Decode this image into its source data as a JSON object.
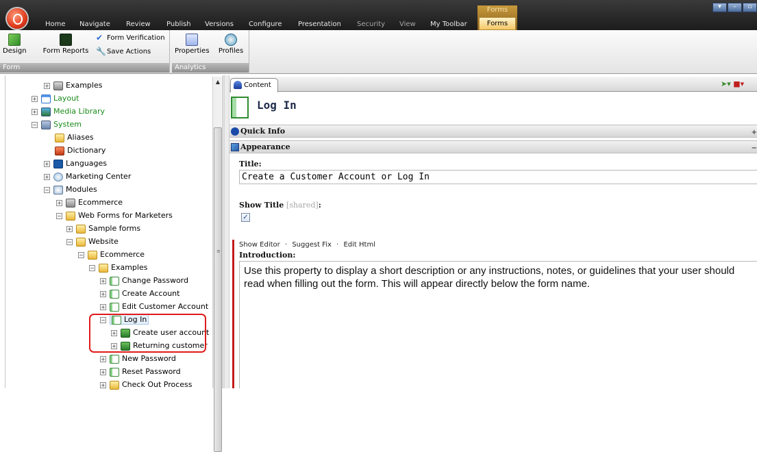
{
  "menu": {
    "items": [
      "Home",
      "Navigate",
      "Review",
      "Publish",
      "Versions",
      "Configure",
      "Presentation",
      "Security",
      "View",
      "My Toolbar"
    ],
    "context_group": "Forms",
    "context_tab": "Forms"
  },
  "ribbon": {
    "form_group": {
      "label": "Form",
      "design": "Design",
      "form_reports": "Form Reports",
      "form_verification": "Form Verification",
      "save_actions": "Save Actions"
    },
    "analytics_group": {
      "label": "Analytics",
      "properties": "Properties",
      "profiles": "Profiles"
    }
  },
  "tree": {
    "nodes": [
      {
        "label": "Examples",
        "icon": "folder-icon"
      },
      {
        "label": "Layout",
        "icon": "layout-icon"
      },
      {
        "label": "Media Library",
        "icon": "media-icon"
      },
      {
        "label": "System",
        "icon": "system-icon"
      },
      {
        "label": "Aliases",
        "icon": "folder-icon"
      },
      {
        "label": "Dictionary",
        "icon": "dictionary-icon"
      },
      {
        "label": "Languages",
        "icon": "language-icon"
      },
      {
        "label": "Marketing Center",
        "icon": "marketing-icon"
      },
      {
        "label": "Modules",
        "icon": "module-icon"
      },
      {
        "label": "Ecommerce",
        "icon": "gear-icon"
      },
      {
        "label": "Web Forms for Marketers",
        "icon": "folder-icon"
      },
      {
        "label": "Sample forms",
        "icon": "folder-icon"
      },
      {
        "label": "Website",
        "icon": "folder-icon"
      },
      {
        "label": "Ecommerce",
        "icon": "folder-icon"
      },
      {
        "label": "Examples",
        "icon": "folder-icon"
      },
      {
        "label": "Change Password",
        "icon": "form-icon"
      },
      {
        "label": "Create Account",
        "icon": "form-icon"
      },
      {
        "label": "Edit Customer Account",
        "icon": "form-icon"
      },
      {
        "label": "Log In",
        "icon": "form-icon"
      },
      {
        "label": "Create user account",
        "icon": "section-icon"
      },
      {
        "label": "Returning customer",
        "icon": "section-icon"
      },
      {
        "label": "New Password",
        "icon": "form-icon"
      },
      {
        "label": "Reset Password",
        "icon": "form-icon"
      },
      {
        "label": "Check Out Process",
        "icon": "folder-icon"
      }
    ]
  },
  "content": {
    "tab_label": "Content",
    "page_title": "Log In",
    "sections": {
      "quick_info": "Quick Info",
      "appearance": "Appearance"
    },
    "fields": {
      "title_label": "Title:",
      "title_value": "Create a Customer Account or Log In",
      "show_title_label": "Show Title",
      "show_title_shared": "[shared]",
      "show_title_colon": ":",
      "show_title_checked": true,
      "editor_links": [
        "Show Editor",
        "Suggest Fix",
        "Edit Html"
      ],
      "introduction_label": "Introduction:",
      "introduction_text": "Use this property to display a short description or any instructions, notes, or guidelines that your user should read when filling out the form. This will appear directly below the form name."
    }
  },
  "colors": {
    "accent_red": "#e01a1a",
    "context_tab_gold": "#f5c766",
    "tree_green_text": "#1a8a1a"
  }
}
